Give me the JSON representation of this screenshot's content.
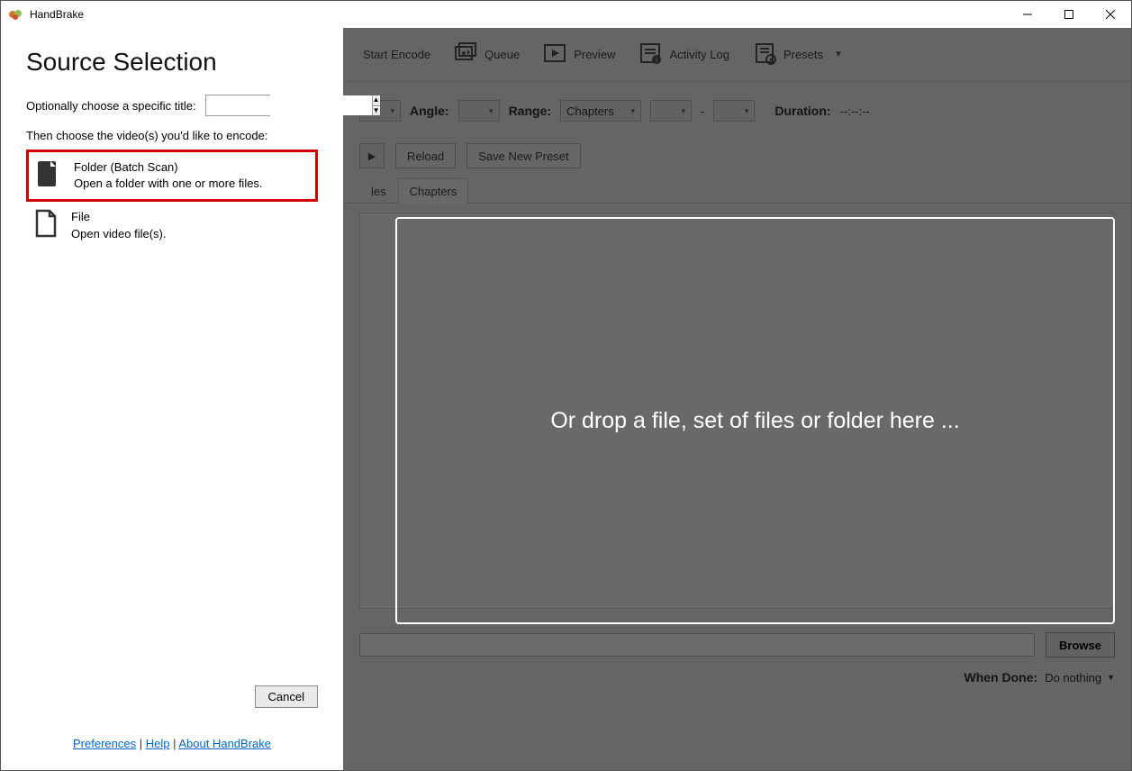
{
  "window": {
    "title": "HandBrake"
  },
  "sidebar": {
    "heading": "Source Selection",
    "optional_title_label": "Optionally choose a specific title:",
    "then_text": "Then choose the video(s) you'd like to encode:",
    "options": {
      "folder": {
        "title": "Folder (Batch Scan)",
        "sub": "Open a folder with one or more files."
      },
      "file": {
        "title": "File",
        "sub": "Open video file(s)."
      }
    },
    "cancel": "Cancel",
    "links": {
      "preferences": "Preferences",
      "help": "Help",
      "about": "About HandBrake",
      "sep": " | "
    }
  },
  "toolbar": {
    "start_encode": "Start Encode",
    "queue": "Queue",
    "preview": "Preview",
    "activity_log": "Activity Log",
    "presets": "Presets"
  },
  "sourcebar": {
    "angle_label": "Angle:",
    "range_label": "Range:",
    "range_value": "Chapters",
    "range_sep": "-",
    "duration_label": "Duration:",
    "duration_value": "--:--:--"
  },
  "presetbar": {
    "reload": "Reload",
    "save_preset": "Save New Preset"
  },
  "tabs": {
    "t1": "les",
    "t2": "Chapters"
  },
  "dropzone": "Or drop a file, set of files or folder here ...",
  "saveas": {
    "browse": "Browse"
  },
  "donebar": {
    "label": "When Done:",
    "value": "Do nothing"
  }
}
